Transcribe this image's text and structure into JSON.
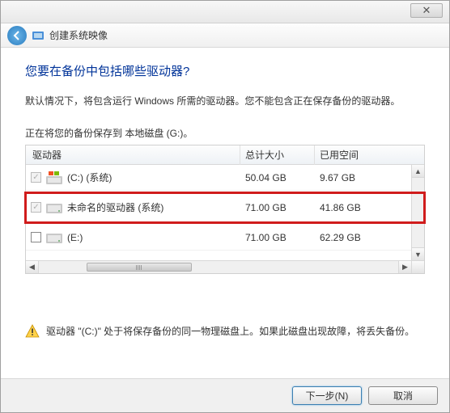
{
  "window": {
    "title": "创建系统映像"
  },
  "heading": "您要在备份中包括哪些驱动器?",
  "subtext": "默认情况下，将包含运行 Windows 所需的驱动器。您不能包含正在保存备份的驱动器。",
  "savedest": "正在将您的备份保存到 本地磁盘 (G:)。",
  "columns": {
    "drive": "驱动器",
    "total": "总计大小",
    "used": "已用空间"
  },
  "rows": [
    {
      "label": "(C:) (系统)",
      "total": "50.04 GB",
      "used": "9.67 GB",
      "checked": true,
      "disabled": true,
      "iconType": "winlogo"
    },
    {
      "label": "未命名的驱动器 (系统)",
      "total": "71.00 GB",
      "used": "41.86 GB",
      "checked": true,
      "disabled": true,
      "iconType": "hdd",
      "highlighted": true
    },
    {
      "label": "(E:)",
      "total": "71.00 GB",
      "used": "62.29 GB",
      "checked": false,
      "disabled": false,
      "iconType": "hdd"
    }
  ],
  "warning": "驱动器 \"(C:)\" 处于将保存备份的同一物理磁盘上。如果此磁盘出现故障，将丢失备份。",
  "buttons": {
    "next": "下一步(N)",
    "cancel": "取消"
  }
}
